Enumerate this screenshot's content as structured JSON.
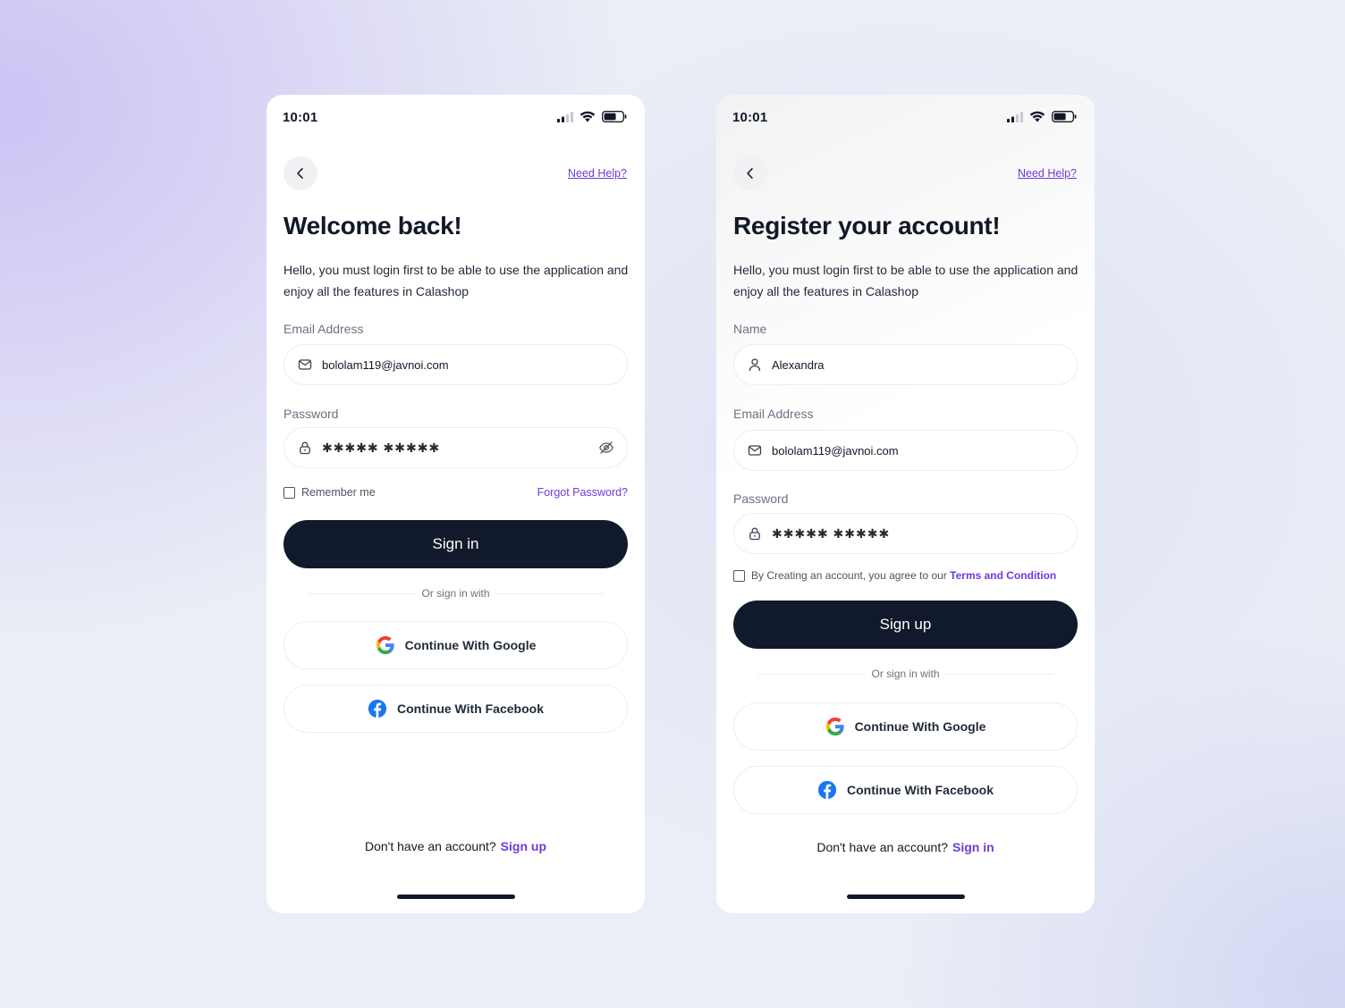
{
  "login": {
    "time": "10:01",
    "help": "Need Help?",
    "title": "Welcome back!",
    "subtitle": "Hello, you must login first to be able to use the application and enjoy all the features in Calashop",
    "email_label": "Email Address",
    "email_value": "bololam119@javnoi.com",
    "password_label": "Password",
    "password_value": "✱✱✱✱✱ ✱✱✱✱✱",
    "remember": "Remember me",
    "forgot": "Forgot Password?",
    "submit": "Sign in",
    "divider": "Or sign in with",
    "google": "Continue With Google",
    "facebook": "Continue With Facebook",
    "footer_text": "Don't have an account?",
    "footer_link": "Sign up"
  },
  "register": {
    "time": "10:01",
    "help": "Need Help?",
    "title": "Register your account!",
    "subtitle": "Hello, you must login first to be able to use the application and enjoy all the features in Calashop",
    "name_label": "Name",
    "name_value": "Alexandra",
    "email_label": "Email Address",
    "email_value": "bololam119@javnoi.com",
    "password_label": "Password",
    "password_value": "✱✱✱✱✱ ✱✱✱✱✱",
    "agree_text": "By Creating an account, you agree to our",
    "agree_link": "Terms and Condition",
    "submit": "Sign up",
    "divider": "Or sign in with",
    "google": "Continue With Google",
    "facebook": "Continue With Facebook",
    "footer_text": "Don't have an account?",
    "footer_link": "Sign in"
  },
  "colors": {
    "accent": "#6d3bd8",
    "primary_button": "#111a2c",
    "facebook": "#1877f2"
  }
}
